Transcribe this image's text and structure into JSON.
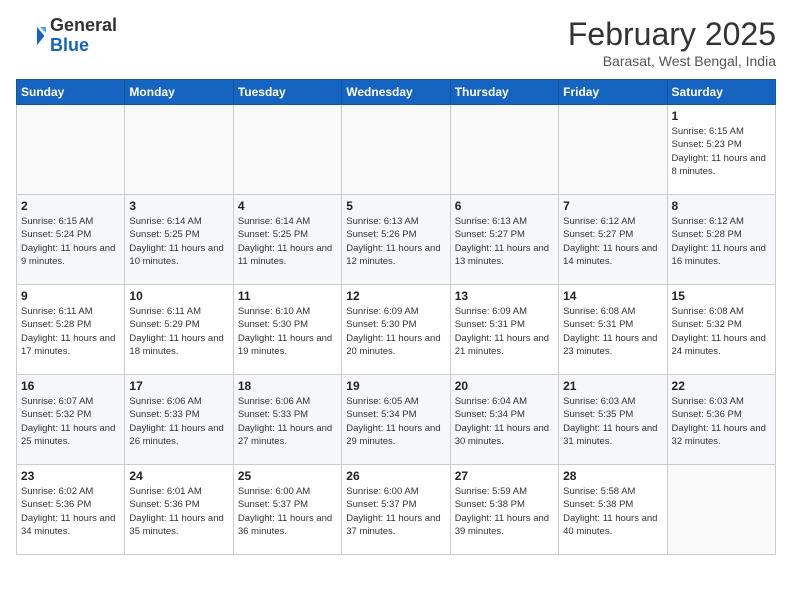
{
  "header": {
    "logo_line1": "General",
    "logo_line2": "Blue",
    "month": "February 2025",
    "location": "Barasat, West Bengal, India"
  },
  "weekdays": [
    "Sunday",
    "Monday",
    "Tuesday",
    "Wednesday",
    "Thursday",
    "Friday",
    "Saturday"
  ],
  "weeks": [
    [
      {
        "day": "",
        "info": ""
      },
      {
        "day": "",
        "info": ""
      },
      {
        "day": "",
        "info": ""
      },
      {
        "day": "",
        "info": ""
      },
      {
        "day": "",
        "info": ""
      },
      {
        "day": "",
        "info": ""
      },
      {
        "day": "1",
        "info": "Sunrise: 6:15 AM\nSunset: 5:23 PM\nDaylight: 11 hours and 8 minutes."
      }
    ],
    [
      {
        "day": "2",
        "info": "Sunrise: 6:15 AM\nSunset: 5:24 PM\nDaylight: 11 hours and 9 minutes."
      },
      {
        "day": "3",
        "info": "Sunrise: 6:14 AM\nSunset: 5:25 PM\nDaylight: 11 hours and 10 minutes."
      },
      {
        "day": "4",
        "info": "Sunrise: 6:14 AM\nSunset: 5:25 PM\nDaylight: 11 hours and 11 minutes."
      },
      {
        "day": "5",
        "info": "Sunrise: 6:13 AM\nSunset: 5:26 PM\nDaylight: 11 hours and 12 minutes."
      },
      {
        "day": "6",
        "info": "Sunrise: 6:13 AM\nSunset: 5:27 PM\nDaylight: 11 hours and 13 minutes."
      },
      {
        "day": "7",
        "info": "Sunrise: 6:12 AM\nSunset: 5:27 PM\nDaylight: 11 hours and 14 minutes."
      },
      {
        "day": "8",
        "info": "Sunrise: 6:12 AM\nSunset: 5:28 PM\nDaylight: 11 hours and 16 minutes."
      }
    ],
    [
      {
        "day": "9",
        "info": "Sunrise: 6:11 AM\nSunset: 5:28 PM\nDaylight: 11 hours and 17 minutes."
      },
      {
        "day": "10",
        "info": "Sunrise: 6:11 AM\nSunset: 5:29 PM\nDaylight: 11 hours and 18 minutes."
      },
      {
        "day": "11",
        "info": "Sunrise: 6:10 AM\nSunset: 5:30 PM\nDaylight: 11 hours and 19 minutes."
      },
      {
        "day": "12",
        "info": "Sunrise: 6:09 AM\nSunset: 5:30 PM\nDaylight: 11 hours and 20 minutes."
      },
      {
        "day": "13",
        "info": "Sunrise: 6:09 AM\nSunset: 5:31 PM\nDaylight: 11 hours and 21 minutes."
      },
      {
        "day": "14",
        "info": "Sunrise: 6:08 AM\nSunset: 5:31 PM\nDaylight: 11 hours and 23 minutes."
      },
      {
        "day": "15",
        "info": "Sunrise: 6:08 AM\nSunset: 5:32 PM\nDaylight: 11 hours and 24 minutes."
      }
    ],
    [
      {
        "day": "16",
        "info": "Sunrise: 6:07 AM\nSunset: 5:32 PM\nDaylight: 11 hours and 25 minutes."
      },
      {
        "day": "17",
        "info": "Sunrise: 6:06 AM\nSunset: 5:33 PM\nDaylight: 11 hours and 26 minutes."
      },
      {
        "day": "18",
        "info": "Sunrise: 6:06 AM\nSunset: 5:33 PM\nDaylight: 11 hours and 27 minutes."
      },
      {
        "day": "19",
        "info": "Sunrise: 6:05 AM\nSunset: 5:34 PM\nDaylight: 11 hours and 29 minutes."
      },
      {
        "day": "20",
        "info": "Sunrise: 6:04 AM\nSunset: 5:34 PM\nDaylight: 11 hours and 30 minutes."
      },
      {
        "day": "21",
        "info": "Sunrise: 6:03 AM\nSunset: 5:35 PM\nDaylight: 11 hours and 31 minutes."
      },
      {
        "day": "22",
        "info": "Sunrise: 6:03 AM\nSunset: 5:36 PM\nDaylight: 11 hours and 32 minutes."
      }
    ],
    [
      {
        "day": "23",
        "info": "Sunrise: 6:02 AM\nSunset: 5:36 PM\nDaylight: 11 hours and 34 minutes."
      },
      {
        "day": "24",
        "info": "Sunrise: 6:01 AM\nSunset: 5:36 PM\nDaylight: 11 hours and 35 minutes."
      },
      {
        "day": "25",
        "info": "Sunrise: 6:00 AM\nSunset: 5:37 PM\nDaylight: 11 hours and 36 minutes."
      },
      {
        "day": "26",
        "info": "Sunrise: 6:00 AM\nSunset: 5:37 PM\nDaylight: 11 hours and 37 minutes."
      },
      {
        "day": "27",
        "info": "Sunrise: 5:59 AM\nSunset: 5:38 PM\nDaylight: 11 hours and 39 minutes."
      },
      {
        "day": "28",
        "info": "Sunrise: 5:58 AM\nSunset: 5:38 PM\nDaylight: 11 hours and 40 minutes."
      },
      {
        "day": "",
        "info": ""
      }
    ]
  ]
}
